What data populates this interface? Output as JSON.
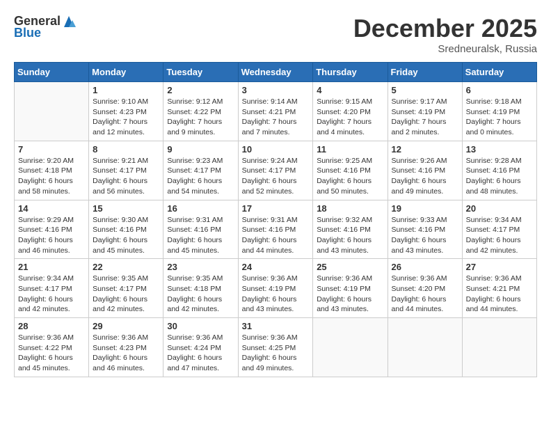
{
  "header": {
    "logo_general": "General",
    "logo_blue": "Blue",
    "month_title": "December 2025",
    "location": "Sredneuralsk, Russia"
  },
  "days_of_week": [
    "Sunday",
    "Monday",
    "Tuesday",
    "Wednesday",
    "Thursday",
    "Friday",
    "Saturday"
  ],
  "weeks": [
    [
      {
        "day": "",
        "info": ""
      },
      {
        "day": "1",
        "info": "Sunrise: 9:10 AM\nSunset: 4:23 PM\nDaylight: 7 hours\nand 12 minutes."
      },
      {
        "day": "2",
        "info": "Sunrise: 9:12 AM\nSunset: 4:22 PM\nDaylight: 7 hours\nand 9 minutes."
      },
      {
        "day": "3",
        "info": "Sunrise: 9:14 AM\nSunset: 4:21 PM\nDaylight: 7 hours\nand 7 minutes."
      },
      {
        "day": "4",
        "info": "Sunrise: 9:15 AM\nSunset: 4:20 PM\nDaylight: 7 hours\nand 4 minutes."
      },
      {
        "day": "5",
        "info": "Sunrise: 9:17 AM\nSunset: 4:19 PM\nDaylight: 7 hours\nand 2 minutes."
      },
      {
        "day": "6",
        "info": "Sunrise: 9:18 AM\nSunset: 4:19 PM\nDaylight: 7 hours\nand 0 minutes."
      }
    ],
    [
      {
        "day": "7",
        "info": "Sunrise: 9:20 AM\nSunset: 4:18 PM\nDaylight: 6 hours\nand 58 minutes."
      },
      {
        "day": "8",
        "info": "Sunrise: 9:21 AM\nSunset: 4:17 PM\nDaylight: 6 hours\nand 56 minutes."
      },
      {
        "day": "9",
        "info": "Sunrise: 9:23 AM\nSunset: 4:17 PM\nDaylight: 6 hours\nand 54 minutes."
      },
      {
        "day": "10",
        "info": "Sunrise: 9:24 AM\nSunset: 4:17 PM\nDaylight: 6 hours\nand 52 minutes."
      },
      {
        "day": "11",
        "info": "Sunrise: 9:25 AM\nSunset: 4:16 PM\nDaylight: 6 hours\nand 50 minutes."
      },
      {
        "day": "12",
        "info": "Sunrise: 9:26 AM\nSunset: 4:16 PM\nDaylight: 6 hours\nand 49 minutes."
      },
      {
        "day": "13",
        "info": "Sunrise: 9:28 AM\nSunset: 4:16 PM\nDaylight: 6 hours\nand 48 minutes."
      }
    ],
    [
      {
        "day": "14",
        "info": "Sunrise: 9:29 AM\nSunset: 4:16 PM\nDaylight: 6 hours\nand 46 minutes."
      },
      {
        "day": "15",
        "info": "Sunrise: 9:30 AM\nSunset: 4:16 PM\nDaylight: 6 hours\nand 45 minutes."
      },
      {
        "day": "16",
        "info": "Sunrise: 9:31 AM\nSunset: 4:16 PM\nDaylight: 6 hours\nand 45 minutes."
      },
      {
        "day": "17",
        "info": "Sunrise: 9:31 AM\nSunset: 4:16 PM\nDaylight: 6 hours\nand 44 minutes."
      },
      {
        "day": "18",
        "info": "Sunrise: 9:32 AM\nSunset: 4:16 PM\nDaylight: 6 hours\nand 43 minutes."
      },
      {
        "day": "19",
        "info": "Sunrise: 9:33 AM\nSunset: 4:16 PM\nDaylight: 6 hours\nand 43 minutes."
      },
      {
        "day": "20",
        "info": "Sunrise: 9:34 AM\nSunset: 4:17 PM\nDaylight: 6 hours\nand 42 minutes."
      }
    ],
    [
      {
        "day": "21",
        "info": "Sunrise: 9:34 AM\nSunset: 4:17 PM\nDaylight: 6 hours\nand 42 minutes."
      },
      {
        "day": "22",
        "info": "Sunrise: 9:35 AM\nSunset: 4:17 PM\nDaylight: 6 hours\nand 42 minutes."
      },
      {
        "day": "23",
        "info": "Sunrise: 9:35 AM\nSunset: 4:18 PM\nDaylight: 6 hours\nand 42 minutes."
      },
      {
        "day": "24",
        "info": "Sunrise: 9:36 AM\nSunset: 4:19 PM\nDaylight: 6 hours\nand 43 minutes."
      },
      {
        "day": "25",
        "info": "Sunrise: 9:36 AM\nSunset: 4:19 PM\nDaylight: 6 hours\nand 43 minutes."
      },
      {
        "day": "26",
        "info": "Sunrise: 9:36 AM\nSunset: 4:20 PM\nDaylight: 6 hours\nand 44 minutes."
      },
      {
        "day": "27",
        "info": "Sunrise: 9:36 AM\nSunset: 4:21 PM\nDaylight: 6 hours\nand 44 minutes."
      }
    ],
    [
      {
        "day": "28",
        "info": "Sunrise: 9:36 AM\nSunset: 4:22 PM\nDaylight: 6 hours\nand 45 minutes."
      },
      {
        "day": "29",
        "info": "Sunrise: 9:36 AM\nSunset: 4:23 PM\nDaylight: 6 hours\nand 46 minutes."
      },
      {
        "day": "30",
        "info": "Sunrise: 9:36 AM\nSunset: 4:24 PM\nDaylight: 6 hours\nand 47 minutes."
      },
      {
        "day": "31",
        "info": "Sunrise: 9:36 AM\nSunset: 4:25 PM\nDaylight: 6 hours\nand 49 minutes."
      },
      {
        "day": "",
        "info": ""
      },
      {
        "day": "",
        "info": ""
      },
      {
        "day": "",
        "info": ""
      }
    ]
  ]
}
